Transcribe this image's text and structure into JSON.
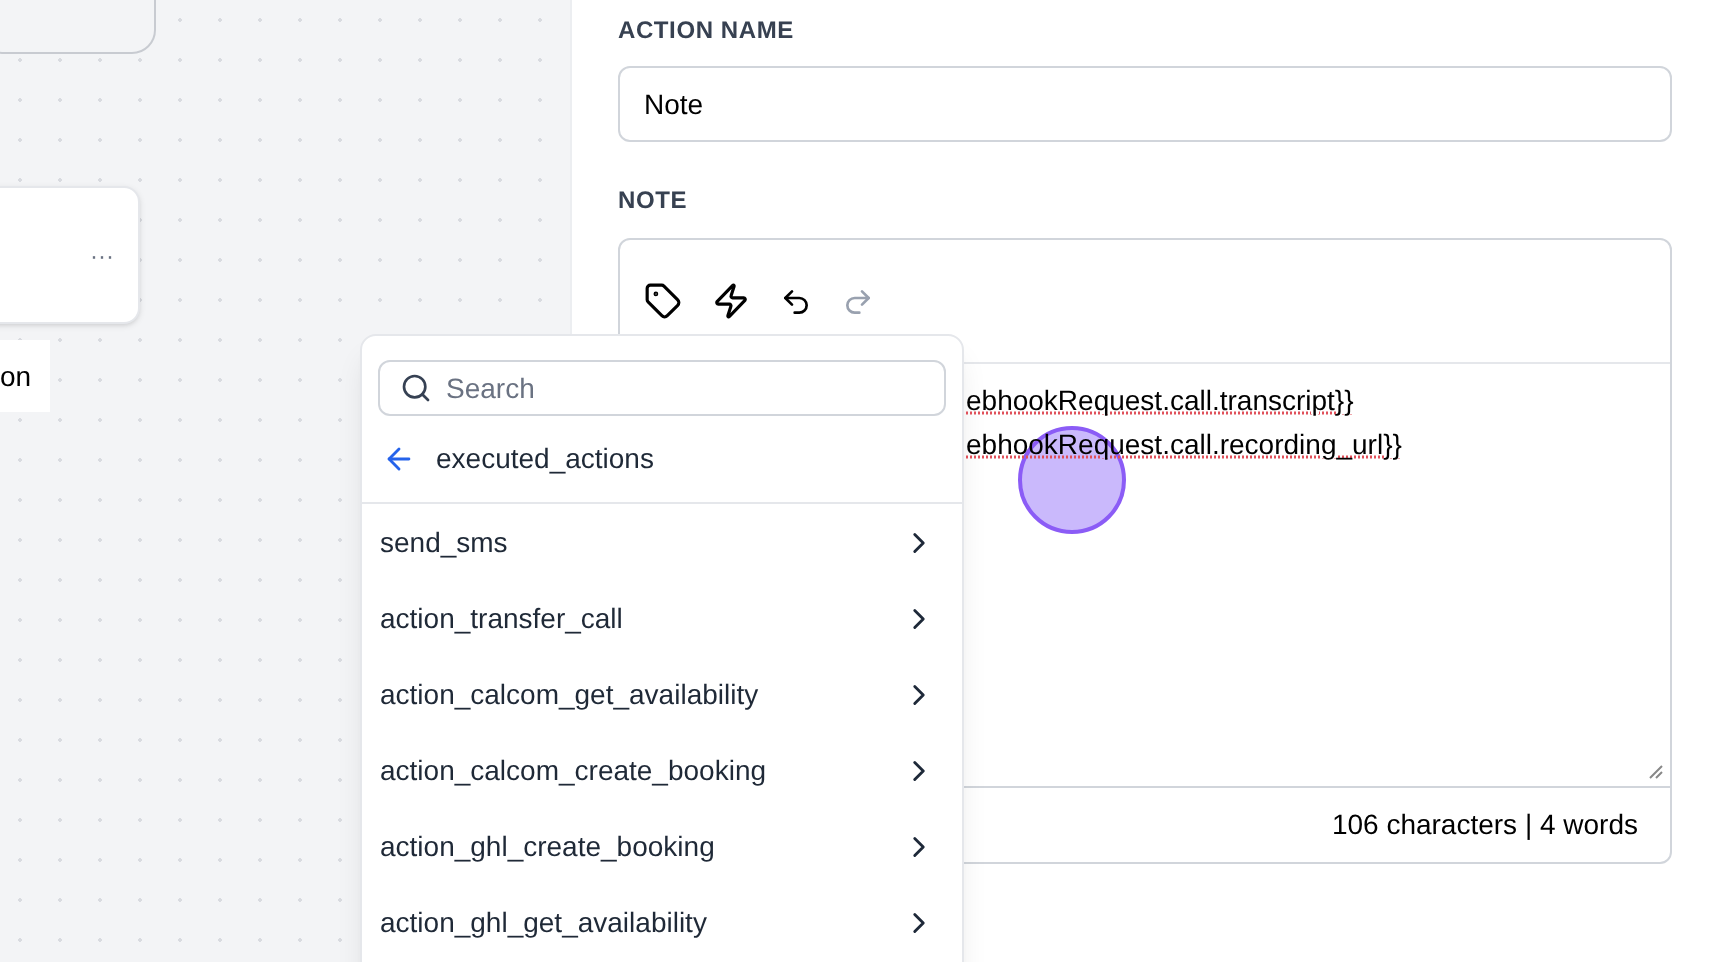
{
  "canvas": {
    "nodes": [
      {
        "kind": "card"
      },
      {
        "kind": "menu-card",
        "menu": "···"
      },
      {
        "kind": "label",
        "text": "on"
      }
    ]
  },
  "action_name": {
    "label": "ACTION NAME",
    "value": "Note"
  },
  "note": {
    "label": "NOTE",
    "toolbar": [
      {
        "kind": "tag",
        "disabled": false
      },
      {
        "kind": "bolt",
        "disabled": false
      },
      {
        "kind": "undo",
        "disabled": false
      },
      {
        "kind": "redo",
        "disabled": true
      }
    ],
    "lines": [
      "ebhookRequest.call.transcript}}",
      "ebhookRequest.call.recording_url}}"
    ],
    "counter": "106 characters | 4 words"
  },
  "popup": {
    "search": {
      "placeholder": "Search"
    },
    "back": "executed_actions",
    "items": [
      {
        "label": "send_sms"
      },
      {
        "label": "action_transfer_call"
      },
      {
        "label": "action_calcom_get_availability"
      },
      {
        "label": "action_calcom_create_booking"
      },
      {
        "label": "action_ghl_create_booking"
      },
      {
        "label": "action_ghl_get_availability"
      }
    ]
  }
}
